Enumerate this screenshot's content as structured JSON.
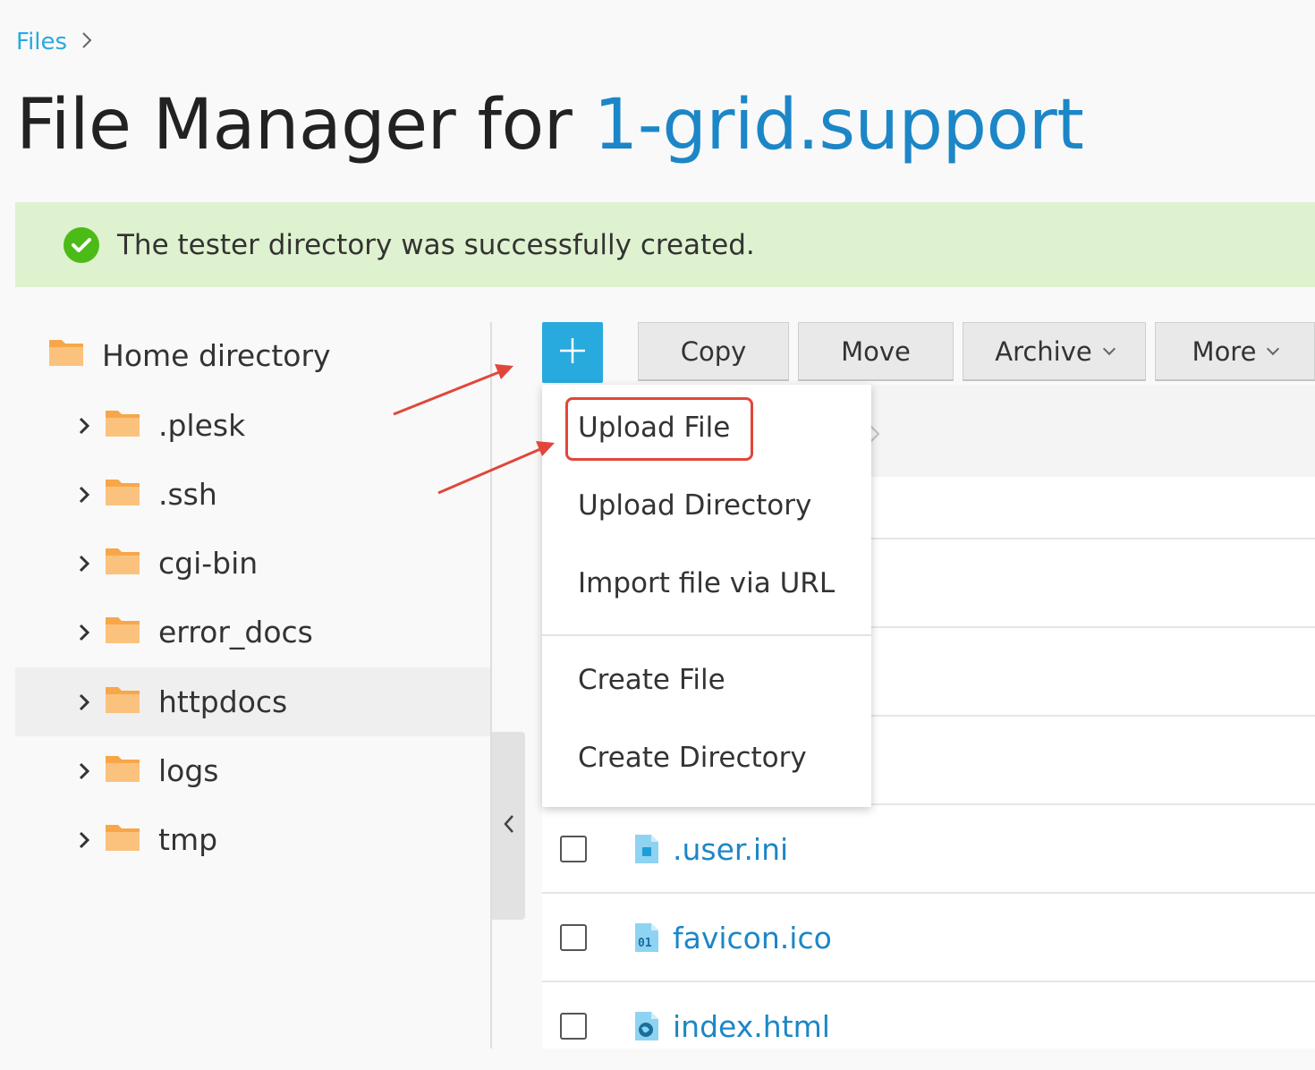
{
  "breadcrumb": {
    "root": "Files"
  },
  "title": {
    "prefix": "File Manager for ",
    "domain": "1-grid.support"
  },
  "notification": {
    "message": "The tester directory was successfully created.",
    "type": "success"
  },
  "sidebar": {
    "root_label": "Home directory",
    "items": [
      {
        "label": ".plesk"
      },
      {
        "label": ".ssh"
      },
      {
        "label": "cgi-bin"
      },
      {
        "label": "error_docs"
      },
      {
        "label": "httpdocs",
        "selected": true
      },
      {
        "label": "logs"
      },
      {
        "label": "tmp"
      }
    ]
  },
  "toolbar": {
    "copy_label": "Copy",
    "move_label": "Move",
    "archive_label": "Archive",
    "more_label": "More"
  },
  "add_menu": {
    "upload_file": "Upload File",
    "upload_directory": "Upload Directory",
    "import_url": "Import file via URL",
    "create_file": "Create File",
    "create_directory": "Create Directory"
  },
  "files": [
    {
      "name": ".user.ini",
      "icon": "document-icon"
    },
    {
      "name": "favicon.ico",
      "icon": "binary-file-icon"
    },
    {
      "name": "index.html",
      "icon": "web-file-icon"
    }
  ],
  "colors": {
    "accent": "#28aade",
    "link": "#1c86c7",
    "success_bg": "#dff2d0",
    "success_icon": "#4cbb17",
    "folder": "#f7a74a",
    "annotation": "#e0473a"
  }
}
